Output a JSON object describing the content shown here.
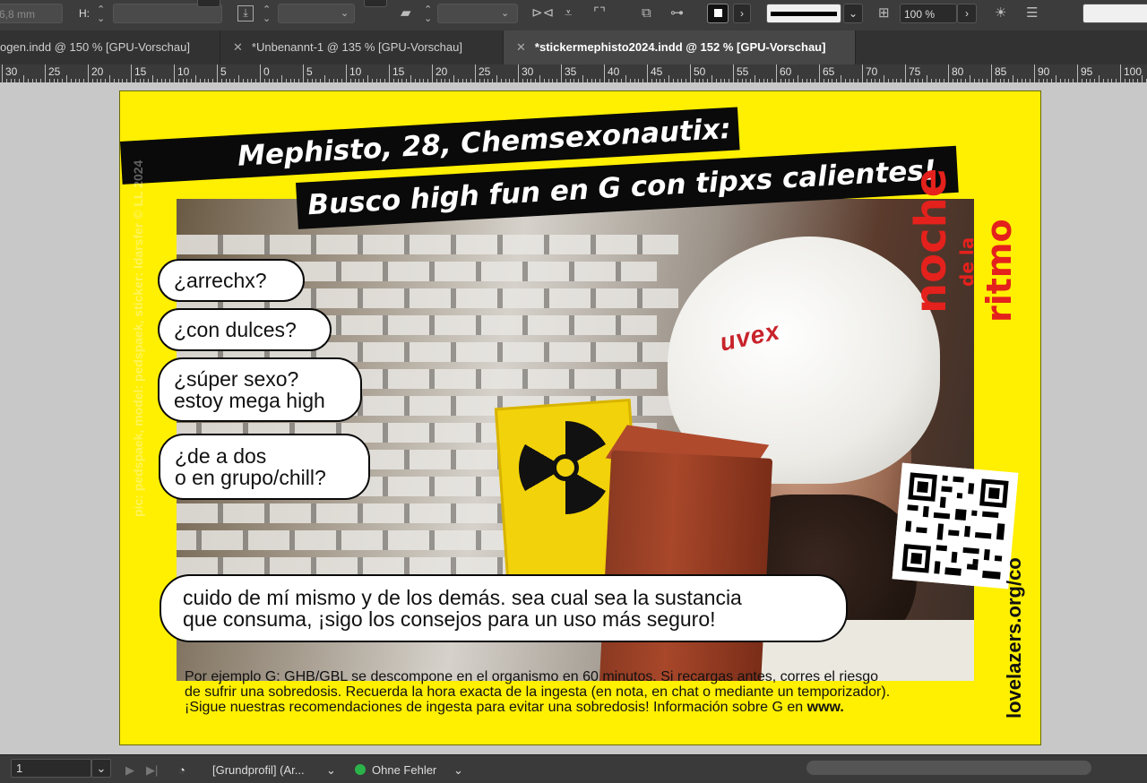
{
  "control_bar": {
    "x_value": "6,8 mm",
    "h_label": "H:",
    "zoom_value": "100 %",
    "icons": [
      "align-icon",
      "shear-icon",
      "flip-horizontal-icon",
      "flip-vertical-icon",
      "reference-point-icon",
      "distribute-icon",
      "stroke-swatch-icon",
      "frame-fit-icon",
      "effects-icon",
      "align-panel-icon"
    ]
  },
  "tabs": [
    {
      "label": "ogen.indd @ 150 % [GPU-Vorschau]",
      "active": false
    },
    {
      "label": "*Unbenannt-1 @ 135 % [GPU-Vorschau]",
      "active": false
    },
    {
      "label": "*stickermephisto2024.indd @ 152 % [GPU-Vorschau]",
      "active": true
    }
  ],
  "ruler": {
    "labels": [
      "30",
      "25",
      "20",
      "15",
      "10",
      "5",
      "0",
      "5",
      "10",
      "15",
      "20",
      "25",
      "30",
      "35",
      "40",
      "45",
      "50",
      "55",
      "60",
      "65",
      "70",
      "75",
      "80",
      "85",
      "90",
      "95",
      "100"
    ]
  },
  "document": {
    "title_line1": "Mephisto, 28, Chemsexonautix:",
    "title_line2": "Busco high fun en G con tipxs calientes!",
    "bubbles": {
      "b1": "¿arrechx?",
      "b2": "¿con dulces?",
      "b3_l1": "¿súper sexo?",
      "b3_l2": "estoy mega high",
      "b4_l1": "¿de a dos",
      "b4_l2": "o en grupo/chill?",
      "b5_l1": "cuido de mí mismo y de los demás. sea cual sea la sustancia",
      "b5_l2": "que consuma, ¡sigo los consejos para un uso más seguro!"
    },
    "side_credit": "pic: pedspaek, model: pedspaek, sticker: Idarsfer   ©   LL   2024",
    "brand_l1": "ritmo",
    "brand_l2": "de la",
    "brand_l3": "noche",
    "url": "lovelazers.org/co",
    "helmet_text": "uvex",
    "fine_l1": "Por ejemplo G: GHB/GBL se descompone en el organismo en 60 minutos. Si recargas antes, corres el riesgo",
    "fine_l2": "de sufrir una sobredosis. Recuerda la hora exacta de la ingesta (en nota, en chat o mediante un temporizador).",
    "fine_l3": "¡Sigue nuestras recomendaciones de ingesta para evitar una sobredosis! Información sobre G en ",
    "fine_l3_bold": "www."
  },
  "status_bar": {
    "page": "1",
    "profile": "[Grundprofil] (Ar...",
    "preflight": "Ohne Fehler",
    "preflight_color": "#2bb34a"
  }
}
